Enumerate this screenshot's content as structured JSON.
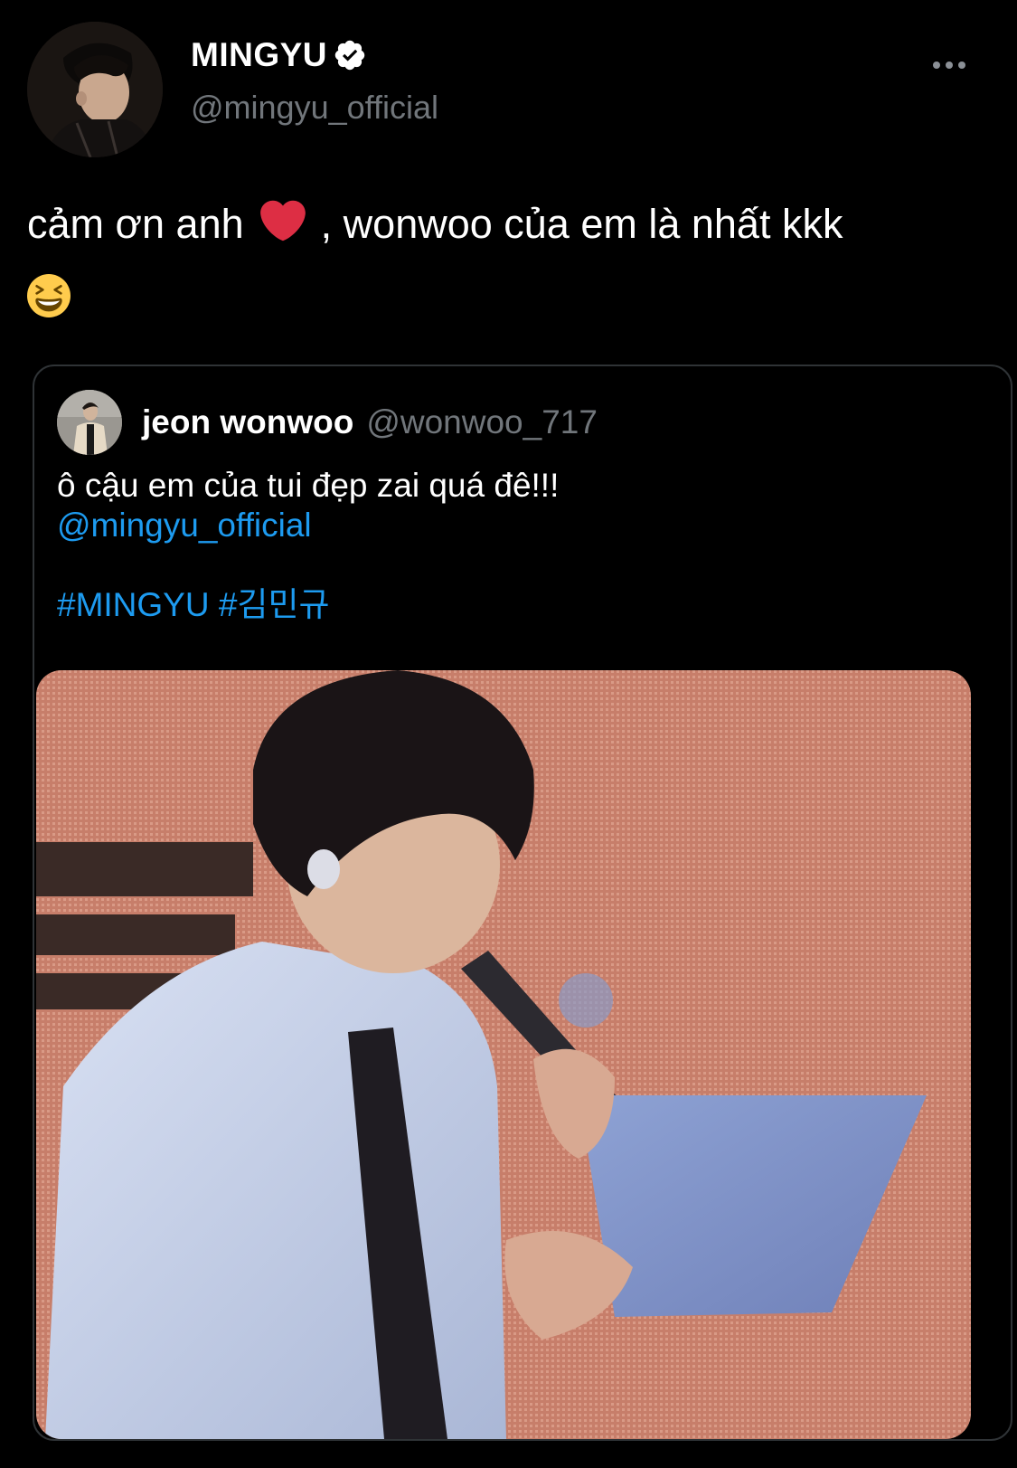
{
  "tweet": {
    "display_name": "MINGYU",
    "handle": "@mingyu_official",
    "verified": true,
    "text_part1": "cảm ơn anh",
    "text_part2": ", wonwoo của em là nhất kkk",
    "emoji_heart": "red-heart",
    "emoji_grin": "grinning-squinting-face",
    "more_icon": "more-horizontal-icon"
  },
  "quote": {
    "display_name": "jeon wonwoo",
    "handle": "@wonwoo_717",
    "text": "ô cậu em của tui đẹp zai quá đê!!!",
    "mention": "@mingyu_official",
    "hashtag1": "#MINGYU",
    "hashtag2": "#김민규"
  },
  "colors": {
    "background": "#000000",
    "text": "#ffffff",
    "secondary": "#71767b",
    "link": "#1d9bf0",
    "border": "#2f3336",
    "verified_badge": "#ffffff"
  }
}
